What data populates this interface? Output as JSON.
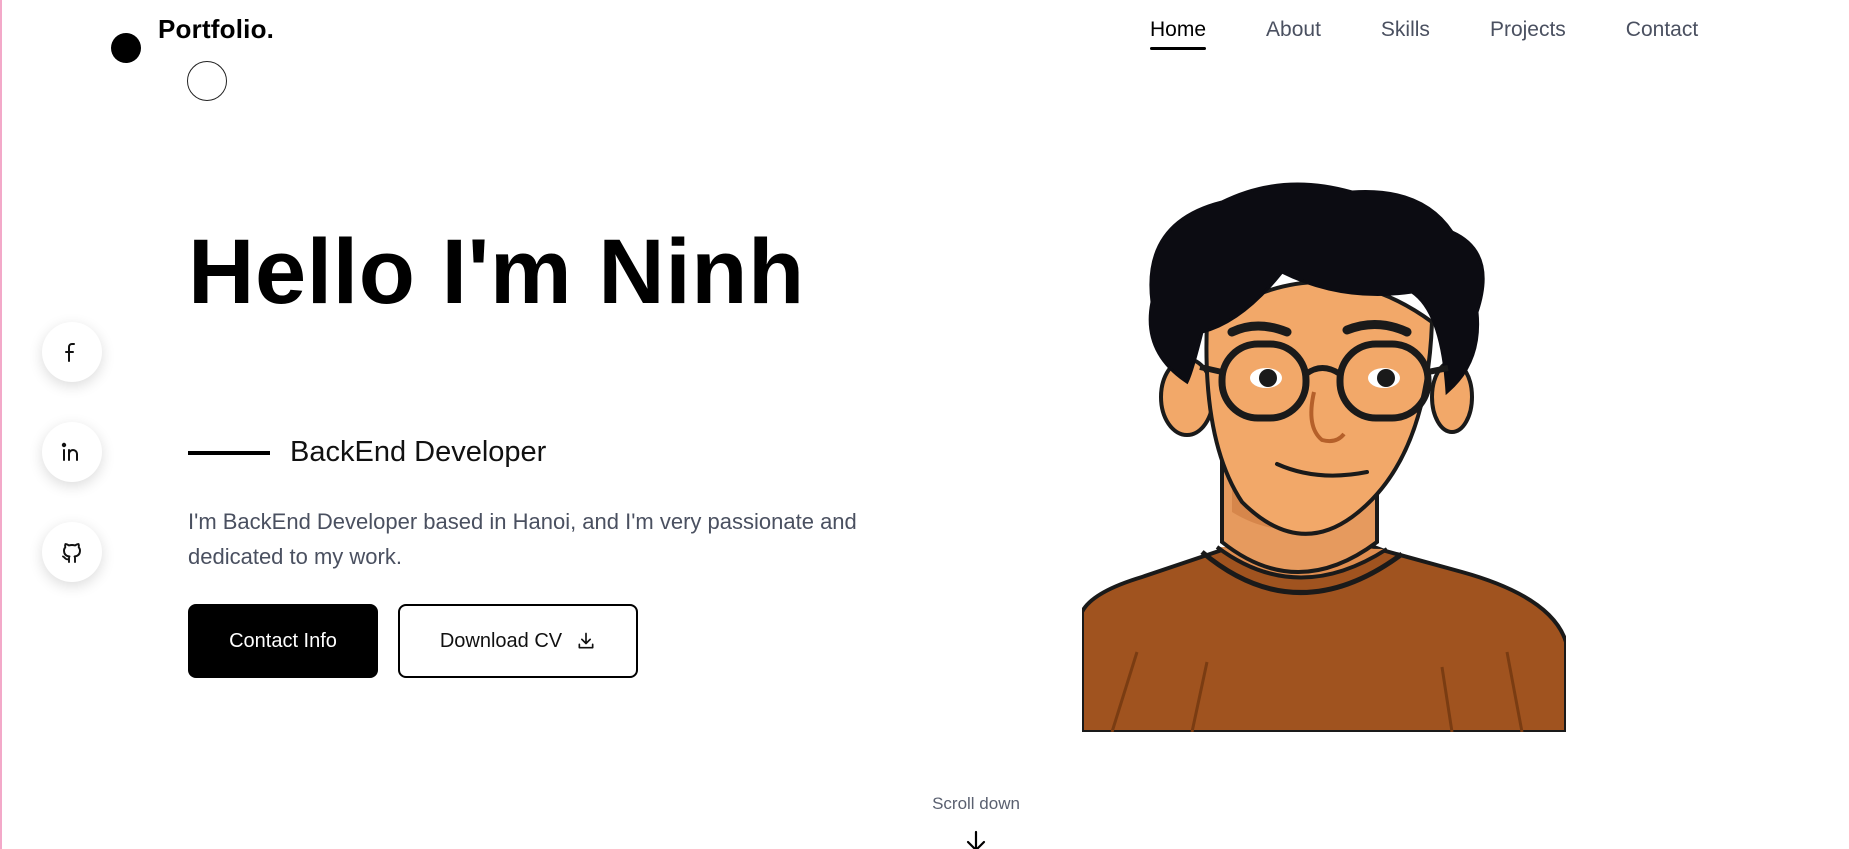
{
  "brand": {
    "logo": "Portfolio."
  },
  "nav": {
    "items": [
      {
        "label": "Home",
        "active": true
      },
      {
        "label": "About"
      },
      {
        "label": "Skills"
      },
      {
        "label": "Projects"
      },
      {
        "label": "Contact"
      }
    ]
  },
  "socials": [
    {
      "icon": "facebook-icon"
    },
    {
      "icon": "linkedin-icon"
    },
    {
      "icon": "github-icon"
    }
  ],
  "hero": {
    "title": "Hello I'm Ninh",
    "role": "BackEnd Developer",
    "description": "I'm BackEnd Developer based in Hanoi, and I'm very passionate and dedicated to my work.",
    "primary_button": "Contact Info",
    "secondary_button": "Download CV"
  },
  "scroll": {
    "label": "Scroll down"
  },
  "colors": {
    "text": "#000000",
    "muted": "#4a5060",
    "accent_edge": "#f3a9c9",
    "shirt": "#a0531f",
    "skin": "#f2a869",
    "hair": "#0c0c12"
  }
}
